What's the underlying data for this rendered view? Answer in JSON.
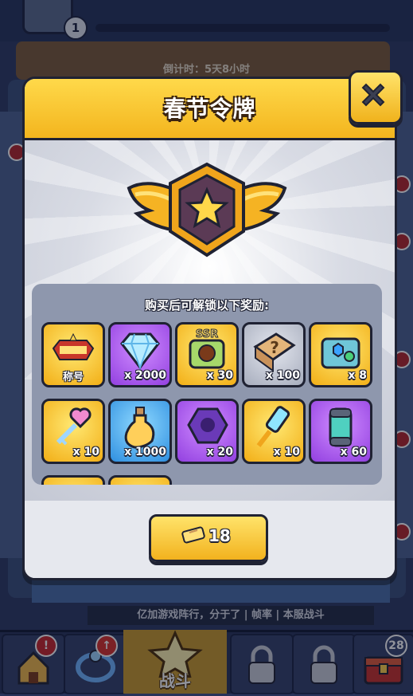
{
  "background": {
    "player_level": "1",
    "countdown": "倒计时：5天8小时",
    "status_text": "亿加游戏阵行，分于了 | 帧率 | 本服战斗",
    "nav": {
      "battle_label": "战斗",
      "chest_badge": "28",
      "alert_badge": "!"
    }
  },
  "modal": {
    "title": "春节令牌",
    "rewards_title": "购买后可解锁以下奖励:",
    "rewards": [
      {
        "icon": "title-plaque-icon",
        "name": "称号",
        "count": "",
        "bg": "gold"
      },
      {
        "icon": "diamond-icon",
        "name": "",
        "count": "x 2000",
        "bg": "purple"
      },
      {
        "icon": "ssr-chest-icon",
        "name": "",
        "count": "x 30",
        "bg": "gold"
      },
      {
        "icon": "mystery-box-icon",
        "name": "",
        "count": "x 100",
        "bg": "grey"
      },
      {
        "icon": "gem-chest-icon",
        "name": "",
        "count": "x 8",
        "bg": "gold"
      },
      {
        "icon": "heart-key-icon",
        "name": "",
        "count": "x 10",
        "bg": "gold"
      },
      {
        "icon": "potion-icon",
        "name": "",
        "count": "x 1000",
        "bg": "blue"
      },
      {
        "icon": "purple-stone-icon",
        "name": "",
        "count": "x 20",
        "bg": "purple"
      },
      {
        "icon": "crystal-key-icon",
        "name": "",
        "count": "x 10",
        "bg": "gold"
      },
      {
        "icon": "energy-canister-icon",
        "name": "",
        "count": "x 60",
        "bg": "purple"
      }
    ],
    "buy_button": {
      "price": "18",
      "icon": "ticket-icon"
    },
    "close_icon": "close-icon"
  },
  "colors": {
    "header_gold": "#f3b51e",
    "outline": "#1f2233",
    "panel_grey": "#8e97ad"
  }
}
